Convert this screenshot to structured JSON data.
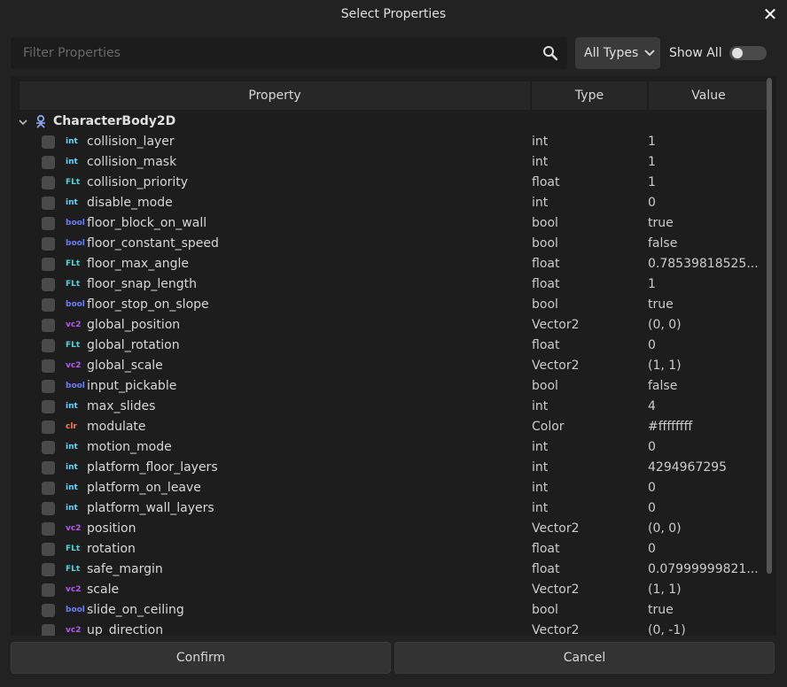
{
  "dialog": {
    "title": "Select Properties"
  },
  "search": {
    "placeholder": "Filter Properties"
  },
  "type_filter": {
    "selected": "All Types"
  },
  "show_all": {
    "label": "Show All",
    "enabled": false
  },
  "table": {
    "headers": [
      "Property",
      "Type",
      "Value"
    ],
    "group": {
      "label": "CharacterBody2D",
      "icon": "character-body-2d-icon",
      "expanded": true
    },
    "type_icons": {
      "int": {
        "text": "int",
        "color": "#5fd6ff"
      },
      "flt": {
        "text": "FLt",
        "color": "#44dcdc"
      },
      "bool": {
        "text": "bool",
        "color": "#6b7dff"
      },
      "vc2": {
        "text": "vc2",
        "color": "#b05cf0"
      },
      "clr": {
        "text": "clr",
        "color": "#ff7a59"
      }
    },
    "rows": [
      {
        "name": "collision_layer",
        "icon": "int",
        "type": "int",
        "value": "1"
      },
      {
        "name": "collision_mask",
        "icon": "int",
        "type": "int",
        "value": "1"
      },
      {
        "name": "collision_priority",
        "icon": "flt",
        "type": "float",
        "value": "1"
      },
      {
        "name": "disable_mode",
        "icon": "int",
        "type": "int",
        "value": "0"
      },
      {
        "name": "floor_block_on_wall",
        "icon": "bool",
        "type": "bool",
        "value": "true"
      },
      {
        "name": "floor_constant_speed",
        "icon": "bool",
        "type": "bool",
        "value": "false"
      },
      {
        "name": "floor_max_angle",
        "icon": "flt",
        "type": "float",
        "value": "0.78539818525..."
      },
      {
        "name": "floor_snap_length",
        "icon": "flt",
        "type": "float",
        "value": "1"
      },
      {
        "name": "floor_stop_on_slope",
        "icon": "bool",
        "type": "bool",
        "value": "true"
      },
      {
        "name": "global_position",
        "icon": "vc2",
        "type": "Vector2",
        "value": "(0, 0)"
      },
      {
        "name": "global_rotation",
        "icon": "flt",
        "type": "float",
        "value": "0"
      },
      {
        "name": "global_scale",
        "icon": "vc2",
        "type": "Vector2",
        "value": "(1, 1)"
      },
      {
        "name": "input_pickable",
        "icon": "bool",
        "type": "bool",
        "value": "false"
      },
      {
        "name": "max_slides",
        "icon": "int",
        "type": "int",
        "value": "4"
      },
      {
        "name": "modulate",
        "icon": "clr",
        "type": "Color",
        "value": "#ffffffff"
      },
      {
        "name": "motion_mode",
        "icon": "int",
        "type": "int",
        "value": "0"
      },
      {
        "name": "platform_floor_layers",
        "icon": "int",
        "type": "int",
        "value": "4294967295"
      },
      {
        "name": "platform_on_leave",
        "icon": "int",
        "type": "int",
        "value": "0"
      },
      {
        "name": "platform_wall_layers",
        "icon": "int",
        "type": "int",
        "value": "0"
      },
      {
        "name": "position",
        "icon": "vc2",
        "type": "Vector2",
        "value": "(0, 0)"
      },
      {
        "name": "rotation",
        "icon": "flt",
        "type": "float",
        "value": "0"
      },
      {
        "name": "safe_margin",
        "icon": "flt",
        "type": "float",
        "value": "0.07999999821..."
      },
      {
        "name": "scale",
        "icon": "vc2",
        "type": "Vector2",
        "value": "(1, 1)"
      },
      {
        "name": "slide_on_ceiling",
        "icon": "bool",
        "type": "bool",
        "value": "true"
      },
      {
        "name": "up_direction",
        "icon": "vc2",
        "type": "Vector2",
        "value": "(0, -1)"
      }
    ]
  },
  "footer": {
    "confirm_label": "Confirm",
    "cancel_label": "Cancel"
  }
}
